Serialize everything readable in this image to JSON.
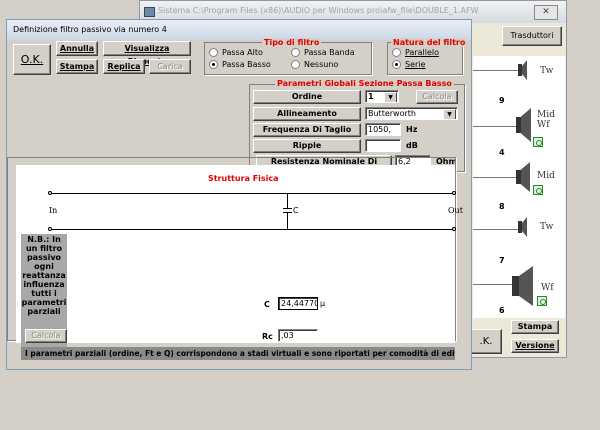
{
  "bg_window": {
    "title": "Sistema C:\\Program Files (x86)\\AUDIO per Windows pro\\afw_file\\DOUBLE_1.AFW",
    "trasduttori_label": "Trasduttori",
    "ok_label": ".K.",
    "stampa_label": "Stampa",
    "versione_label": "Versione",
    "speakers": [
      {
        "type": "Tw",
        "number": "9"
      },
      {
        "type": "Mid Wf",
        "number": "4"
      },
      {
        "type": "Mid",
        "number": "8"
      },
      {
        "type": "Tw",
        "number": "7"
      },
      {
        "type": "Wf",
        "number": "6"
      }
    ]
  },
  "dialog": {
    "title": "Definizione filtro passivo via numero 4",
    "buttons": {
      "ok": "O.K.",
      "annulla": "Annulla",
      "visualizza": "Visualizza Risposta",
      "stampa": "Stampa",
      "replica": "Replica",
      "carica": "Carica"
    },
    "tipo_filtro": {
      "title": "Tipo di filtro",
      "options": [
        "Passa Alto",
        "Passa Banda",
        "Passa Basso",
        "Nessuno"
      ],
      "selected": "Passa Basso"
    },
    "natura_filtro": {
      "title": "Natura del filtro",
      "options": [
        "Parallelo",
        "Serie"
      ],
      "selected": "Serie"
    },
    "parametri": {
      "title": "Parametri Globali Sezione Passa Basso",
      "ordine_label": "Ordine",
      "ordine_value": "1",
      "calcola_label": "Calcola",
      "allineamento_label": "Allineamento",
      "allineamento_value": "Butterworth",
      "frequenza_label": "Frequenza Di Taglio",
      "frequenza_value": "1050,",
      "frequenza_unit": "Hz",
      "ripple_label": "Ripple",
      "ripple_value": "",
      "ripple_unit": "dB",
      "resistenza_label": "Resistenza Nominale Di Carico",
      "resistenza_value": "6,2",
      "resistenza_unit": "Ohm"
    },
    "struttura": {
      "title": "Struttura Fisica",
      "in_label": "In",
      "out_label": "Out",
      "cap_label": "C",
      "nb_text": "N.B.: In un filtro passivo ogni reattanza influenza tutti i parametri parziali",
      "c_label": "C",
      "c_value": "24,44770",
      "c_unit": "µ",
      "rc_label": "Rc",
      "rc_value": ",03",
      "calcola_label": "Calcola",
      "info": "I parametri parziali (ordine, Ft e Q) corrispondono a stadi virtuali e sono riportati per comodità di editing"
    }
  }
}
